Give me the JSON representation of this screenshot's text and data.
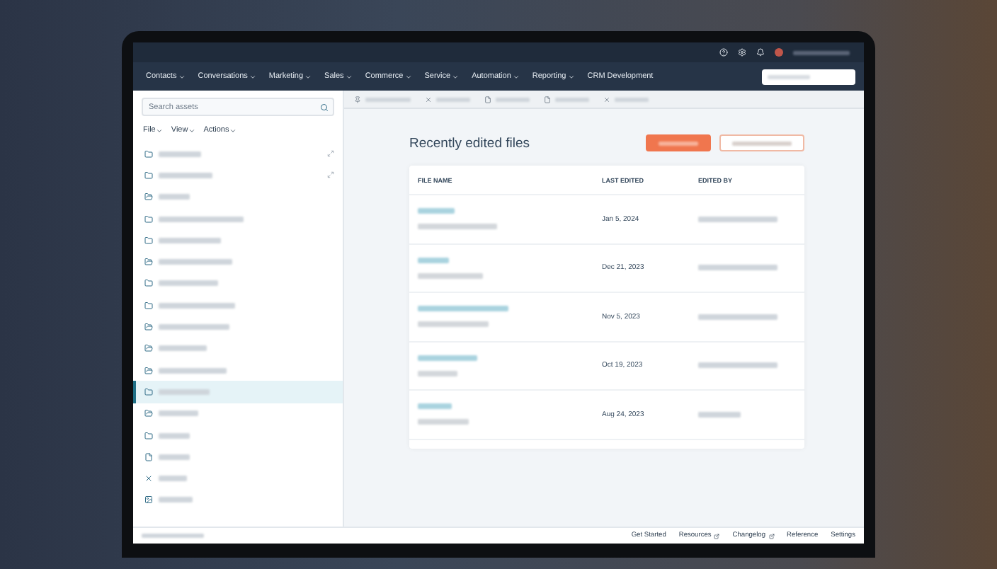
{
  "nav": {
    "items": [
      {
        "label": "Contacts"
      },
      {
        "label": "Conversations"
      },
      {
        "label": "Marketing"
      },
      {
        "label": "Sales"
      },
      {
        "label": "Commerce"
      },
      {
        "label": "Service"
      },
      {
        "label": "Automation"
      },
      {
        "label": "Reporting"
      },
      {
        "label": "CRM Development"
      }
    ]
  },
  "sidebar": {
    "search": {
      "placeholder": "Search assets"
    },
    "menus": [
      "File",
      "View",
      "Actions"
    ],
    "items": [
      {
        "kind": "folder",
        "selected": false
      },
      {
        "kind": "folder",
        "selected": false
      },
      {
        "kind": "folder-open",
        "selected": false
      },
      {
        "kind": "folder",
        "selected": false
      },
      {
        "kind": "folder",
        "selected": false
      },
      {
        "kind": "folder-open",
        "selected": false
      },
      {
        "kind": "folder",
        "selected": false
      },
      {
        "kind": "folder",
        "selected": false
      },
      {
        "kind": "folder-open",
        "selected": false
      },
      {
        "kind": "folder-open",
        "selected": false
      },
      {
        "kind": "folder-open",
        "selected": false
      },
      {
        "kind": "folder",
        "selected": true
      },
      {
        "kind": "folder-open",
        "selected": false
      },
      {
        "kind": "folder",
        "selected": false
      },
      {
        "kind": "file",
        "selected": false
      },
      {
        "kind": "close",
        "selected": false
      },
      {
        "kind": "image",
        "selected": false
      }
    ]
  },
  "editor_tabs": [
    {
      "kind": "pin"
    },
    {
      "kind": "close"
    },
    {
      "kind": "file"
    },
    {
      "kind": "file"
    },
    {
      "kind": "close"
    }
  ],
  "main": {
    "title": "Recently edited files",
    "buttons": [
      {
        "kind": "primary"
      },
      {
        "kind": "secondary"
      }
    ],
    "table": {
      "columns": [
        "FILE NAME",
        "LAST EDITED",
        "EDITED BY"
      ],
      "rows": [
        {
          "last_edited": "Jan 5, 2024"
        },
        {
          "last_edited": "Dec 21, 2023"
        },
        {
          "last_edited": "Nov 5, 2023"
        },
        {
          "last_edited": "Oct 19, 2023"
        },
        {
          "last_edited": "Aug 24, 2023"
        }
      ]
    }
  },
  "footer": {
    "links": [
      "Get Started",
      "Resources",
      "Changelog",
      "Reference",
      "Settings"
    ]
  }
}
